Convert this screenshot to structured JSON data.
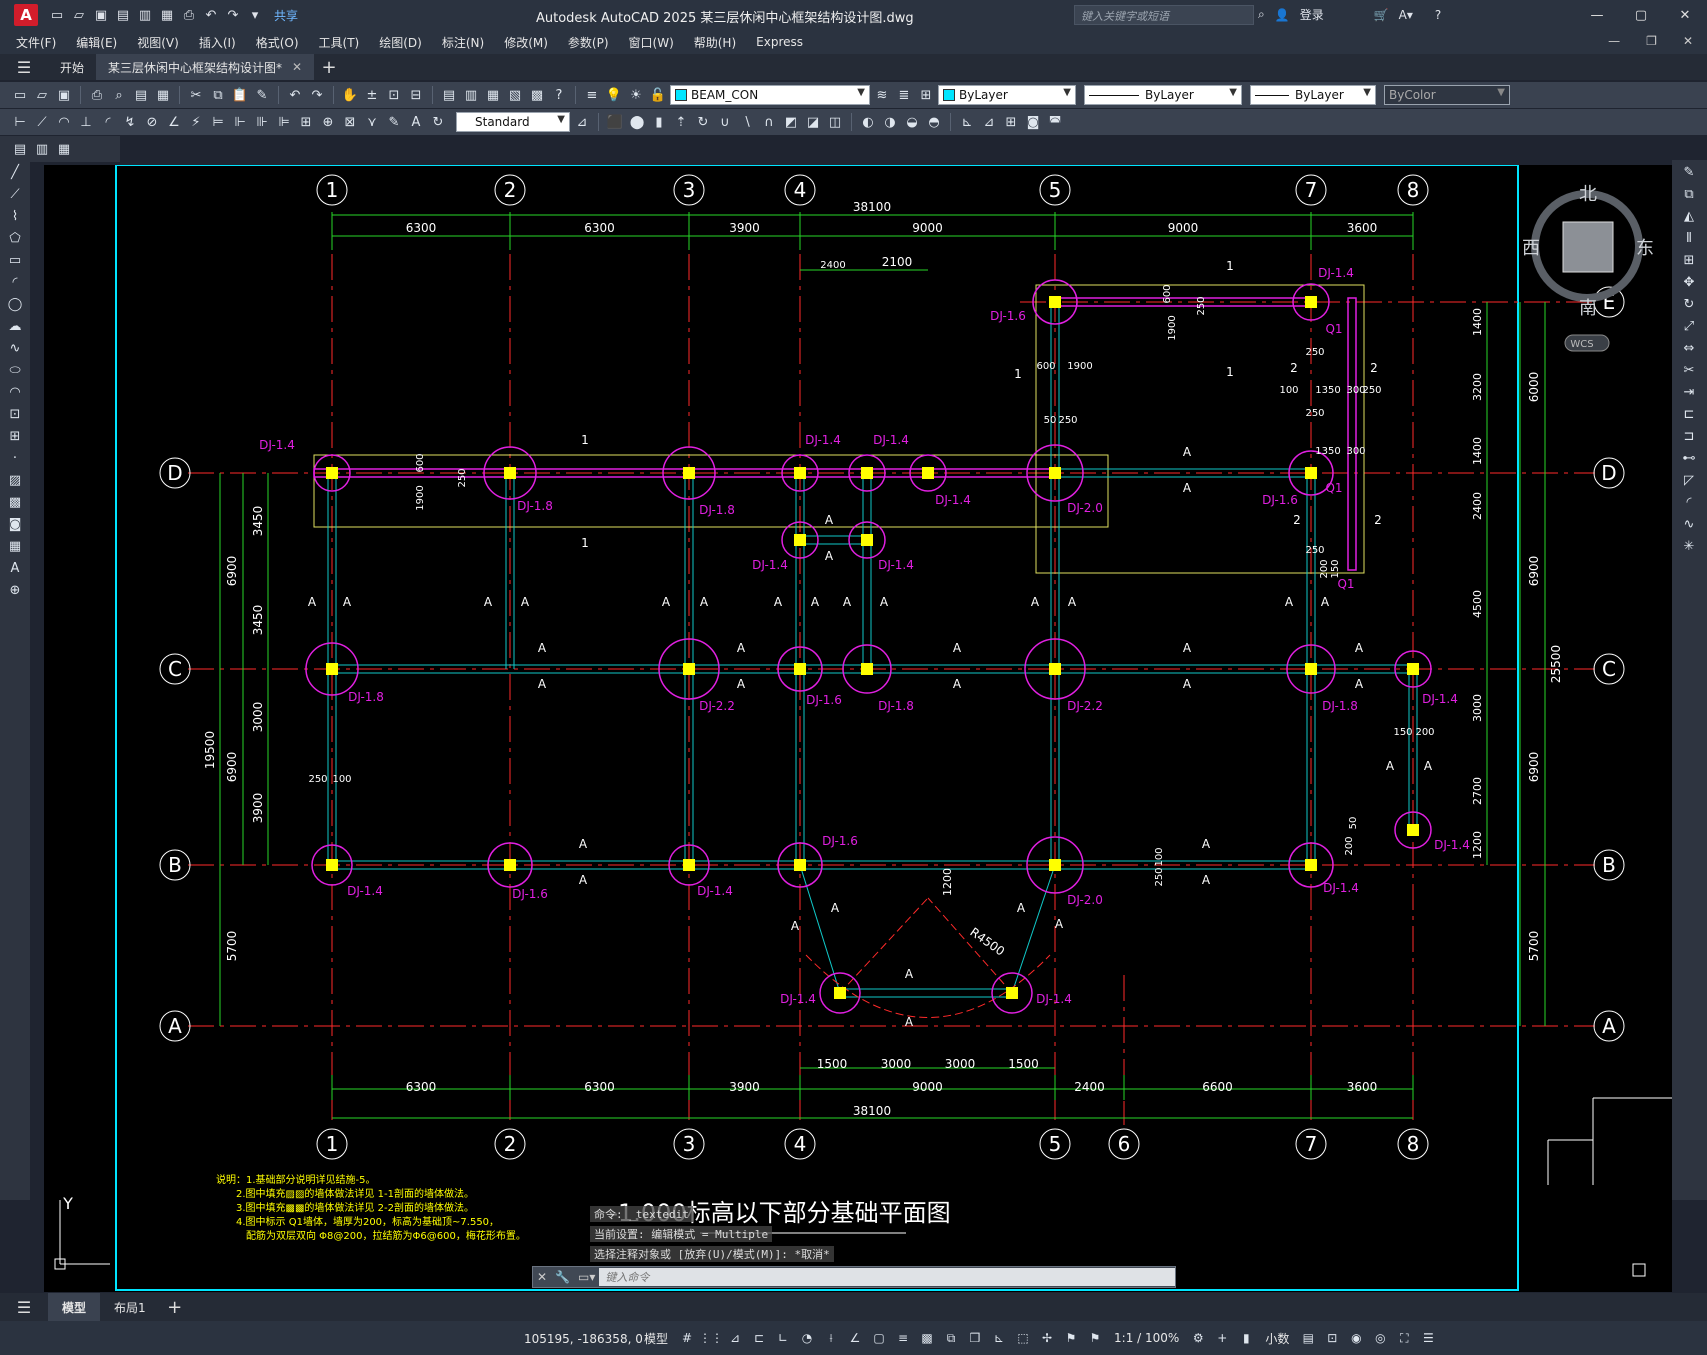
{
  "app": {
    "logo": "A",
    "window_title": "Autodesk AutoCAD 2025    某三层休闲中心框架结构设计图.dwg",
    "share_label": "共享",
    "search_placeholder": "键入关键字或短语",
    "login_label": "登录",
    "help_icon": "?"
  },
  "menu": [
    "文件(F)",
    "编辑(E)",
    "视图(V)",
    "插入(I)",
    "格式(O)",
    "工具(T)",
    "绘图(D)",
    "标注(N)",
    "修改(M)",
    "参数(P)",
    "窗口(W)",
    "帮助(H)",
    "Express"
  ],
  "tabs": {
    "start": "开始",
    "active_doc": "某三层休闲中心框架结构设计图*"
  },
  "toolbar": {
    "layer": "BEAM_CON",
    "color": "ByLayer",
    "linetype": "ByLayer",
    "lineweight": "ByLayer",
    "plotstyle": "ByColor",
    "textstyle": "Standard"
  },
  "colors": {
    "axis": "#ff2a2a",
    "dim": "#27d627",
    "beam": "#10c8c8",
    "footing": "#e020e0",
    "column": "#ffff00",
    "border": "#00e5ff",
    "wall": "#e0e060"
  },
  "drawing": {
    "axis_top": [
      "1",
      "2",
      "3",
      "4",
      "5",
      "7",
      "8"
    ],
    "axis_bottom": [
      "1",
      "2",
      "3",
      "4",
      "5",
      "6",
      "7",
      "8"
    ],
    "axis_left": [
      "D",
      "C",
      "B",
      "A"
    ],
    "axis_right": [
      "E",
      "D",
      "C",
      "B",
      "A"
    ],
    "dims_top_total": "38100",
    "dims_top": [
      "6300",
      "6300",
      "3900",
      "9000",
      "9000",
      "3600"
    ],
    "dims_top_small": [
      "2400",
      "2100"
    ],
    "dims_bottom_small": [
      "1500",
      "3000",
      "3000",
      "1500"
    ],
    "dims_bottom": [
      "6300",
      "6300",
      "3900",
      "9000",
      "2400",
      "6600",
      "3600"
    ],
    "dims_bottom_total": "38100",
    "dims_left_outer": [
      "19500",
      "5700"
    ],
    "dims_left_mid": [
      "6900",
      "6900"
    ],
    "dims_left_inner": [
      "3450",
      "3450",
      "3000",
      "3900"
    ],
    "dims_right_outer": "25500",
    "dims_right_mid": [
      "6000",
      "6900",
      "6900",
      "5700"
    ],
    "dims_right_inner": [
      "1400",
      "3200",
      "1400",
      "2400",
      "4500",
      "3000",
      "2700",
      "1200"
    ],
    "footing_labels": {
      "d1": "DJ-1.4",
      "d2": "DJ-1.8",
      "d3": "DJ-1.8",
      "d4a": "DJ-1.4",
      "d4b": "DJ-1.4",
      "d4c": "DJ-1.4",
      "d5": "DJ-2.0",
      "d7": "DJ-1.6",
      "e5": "DJ-1.6",
      "e7": "DJ-1.4",
      "c1": "DJ-1.8",
      "c3": "DJ-2.2",
      "c4": "DJ-1.6",
      "c4b": "DJ-1.8",
      "c5": "DJ-2.2",
      "c7": "DJ-1.8",
      "c8": "DJ-1.4",
      "m4": "DJ-1.4",
      "m4b": "DJ-1.4",
      "b1": "DJ-1.4",
      "b2": "DJ-1.6",
      "b3": "DJ-1.4",
      "b4": "DJ-1.6",
      "b5": "DJ-2.0",
      "b7": "DJ-1.4",
      "b8": "DJ-1.4",
      "a1": "DJ-1.4",
      "a2": "DJ-1.4"
    },
    "misc_labels": {
      "radius": "R4500",
      "q1": "Q1",
      "sec_a": "A",
      "sec_1": "1",
      "sec_2": "2",
      "d250": "250",
      "d1900": "1900",
      "d600": "600",
      "d1350": "1350",
      "d300": "300",
      "d100": "100",
      "d150": "150",
      "d200": "200",
      "d50": "50",
      "d1200": "1200"
    },
    "title": "-1.000标高以下部分基础平面图",
    "notes": [
      "说明：1.基础部分说明详见结施-5。",
      "2.图中填充▨▨的墙体做法详见 1-1剖面的墙体做法。",
      "3.图中填充▩▩的墙体做法详见 2-2剖面的墙体做法。",
      "4.图中标示 Q1墙体，墙厚为200，标高为基础顶~7.550，",
      "配筋为双层双向 Φ8@200，拉结筋为Φ6@600，梅花形布置。"
    ],
    "ucs_y": "Y"
  },
  "viewcube": {
    "north": "北",
    "south": "南",
    "east": "东",
    "west": "西",
    "wcs": "WCS"
  },
  "command": {
    "history": [
      "命令: _textedit",
      "当前设置: 编辑模式 = Multiple",
      "选择注释对象或 [放弃(U)/模式(M)]: *取消*"
    ],
    "placeholder": "键入命令"
  },
  "layouts": [
    "模型",
    "布局1"
  ],
  "status": {
    "coords": "105195, -186358, 0",
    "model": "模型",
    "scale": "1:1 / 100%",
    "units": "小数"
  }
}
